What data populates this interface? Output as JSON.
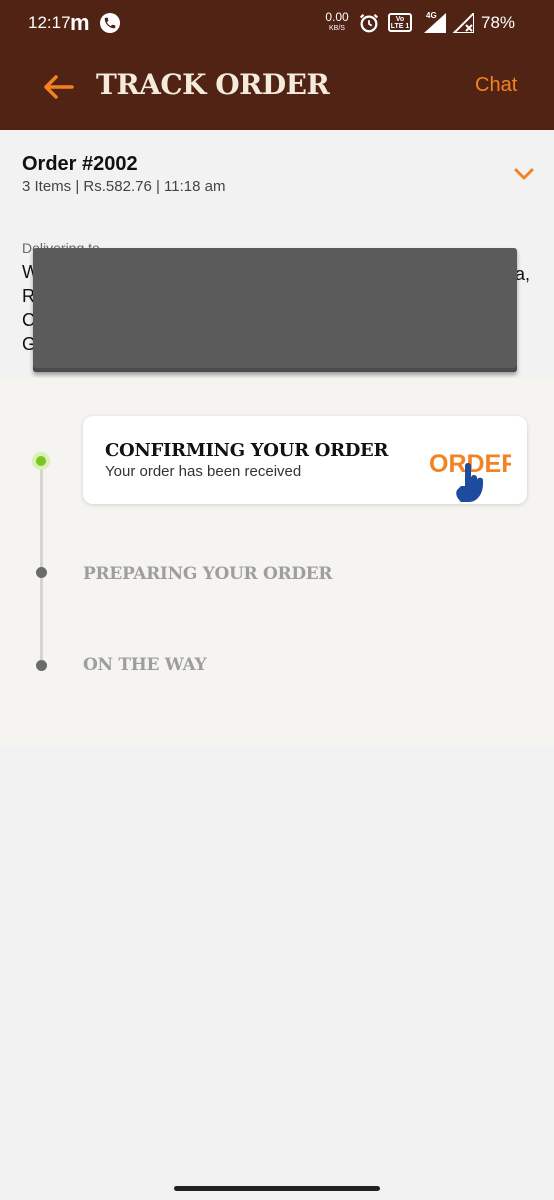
{
  "status_bar": {
    "time": "12:17",
    "carrier_icon": "m",
    "speed_value": "0.00",
    "speed_unit": "KB/S",
    "volte_label": "Vo LTE 1",
    "network": "4G",
    "battery": "78%"
  },
  "header": {
    "title": "TRACK ORDER",
    "chat_label": "Chat",
    "back_icon": "arrow-left-icon"
  },
  "order": {
    "number": "Order #2002",
    "meta": "3 Items | Rs.582.76 | 11:18 am",
    "delivering_label": "Delivering to",
    "address_line_1": "W",
    "address_line_2": "R",
    "address_line_3": "C",
    "address_line_4": "G",
    "address_end": "a,"
  },
  "tracking": {
    "steps": [
      {
        "title": "CONFIRMING YOUR ORDER",
        "subtitle": "Your order has been received",
        "badge": "ORDER",
        "status": "active"
      },
      {
        "title": "PREPARING YOUR ORDER",
        "status": "pending"
      },
      {
        "title": "ON THE WAY",
        "status": "pending"
      }
    ]
  },
  "colors": {
    "header_bg": "#502314",
    "accent": "#f58220",
    "title_cream": "#f5ebdc",
    "active_green": "#7cc426",
    "badge_blue": "#1f4b9e"
  }
}
